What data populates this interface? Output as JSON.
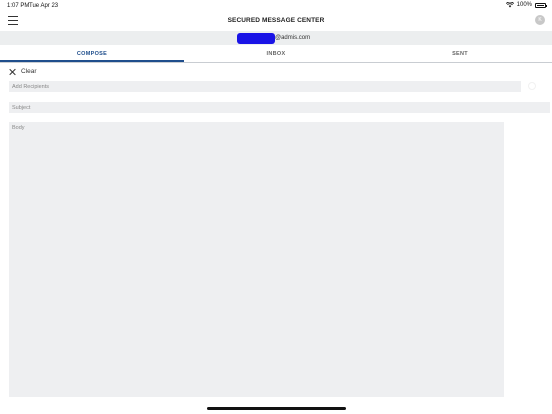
{
  "status_bar": {
    "time": "1:07 PM",
    "date": "Tue Apr 23",
    "battery": "100%"
  },
  "header": {
    "title": "SECURED MESSAGE CENTER",
    "avatar_initial": "K"
  },
  "account": {
    "email_domain": "@admis.com"
  },
  "tabs": [
    {
      "label": "COMPOSE",
      "active": true
    },
    {
      "label": "INBOX",
      "active": false
    },
    {
      "label": "SENT",
      "active": false
    }
  ],
  "compose": {
    "clear_label": "Clear",
    "recipients_placeholder": "Add Recipients",
    "subject_placeholder": "Subject",
    "body_placeholder": "Body"
  },
  "colors": {
    "accent": "#1f4e8c",
    "field_bg": "#eeeff1",
    "redaction": "#1a14e6"
  }
}
